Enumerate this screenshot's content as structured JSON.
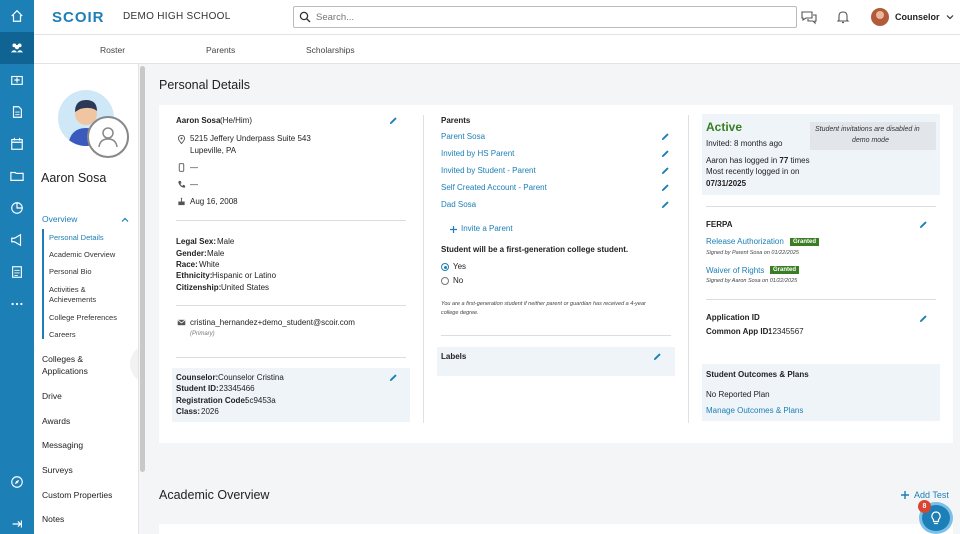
{
  "brand": {
    "logo": "SCOIR",
    "school": "DEMO HIGH SCHOOL",
    "accent": "#1c7fb6"
  },
  "search": {
    "placeholder": "Search..."
  },
  "user": {
    "name": "Counselor"
  },
  "rail_icons": [
    "home-icon",
    "users-icon",
    "college-icon",
    "document-icon",
    "calendar-icon",
    "folder-icon",
    "pie-chart-icon",
    "megaphone-icon",
    "list-icon",
    "more-icon",
    "compass-icon",
    "expand-icon"
  ],
  "subnav": {
    "tabs": [
      "Roster",
      "Parents",
      "Scholarships"
    ]
  },
  "student": {
    "name": "Aaron Sosa"
  },
  "leftnav": {
    "overview": "Overview",
    "overview_items": [
      "Personal Details",
      "Academic Overview",
      "Personal Bio",
      "Activities &",
      "Achievements",
      "College Preferences",
      "Careers"
    ],
    "sections": [
      "Colleges &",
      "Applications",
      "Drive",
      "Awards",
      "Messaging",
      "Surveys",
      "Custom Properties",
      "Notes"
    ]
  },
  "page": {
    "title": "Personal Details",
    "section2": "Academic Overview",
    "add_test": "Add Test"
  },
  "col1": {
    "name": "Aaron Sosa",
    "pronouns": "(He/Him)",
    "address1": "5215 Jeffery Underpass Suite 543",
    "address2": "Lupeville, PA",
    "mobile": "—",
    "phone": "—",
    "birthday": "Aug 16, 2008",
    "demographics": [
      {
        "label": "Legal Sex:",
        "value": "Male"
      },
      {
        "label": "Gender:",
        "value": "Male"
      },
      {
        "label": "Race:",
        "value": "White"
      },
      {
        "label": "Ethnicity:",
        "value": "Hispanic or Latino"
      },
      {
        "label": "Citizenship:",
        "value": "United States"
      }
    ],
    "email": "cristina_hernandez+demo_student@scoir.com",
    "email_tag": "(Primary)",
    "school_info": [
      {
        "label": "Counselor:",
        "value": "Counselor Cristina"
      },
      {
        "label": "Student ID:",
        "value": "23345466"
      },
      {
        "label": "Registration Code:",
        "value": "5c9453a"
      },
      {
        "label": "Class:",
        "value": "2026"
      }
    ]
  },
  "col2": {
    "title": "Parents",
    "parents": [
      "Parent Sosa",
      "Invited by HS Parent",
      "Invited by Student - Parent",
      "Self Created Account - Parent",
      "Dad Sosa"
    ],
    "invite": "Invite a Parent",
    "first_gen_q": "Student will be a first-generation college student.",
    "yes": "Yes",
    "no": "No",
    "first_gen_selected": "Yes",
    "note1": "You are a first-generation student if neither parent or guardian has received a 4-year",
    "note2": "college degree.",
    "labels": "Labels"
  },
  "col3": {
    "status": "Active",
    "invited": "Invited: 8 months ago",
    "demo_note1": "Student invitations are disabled in",
    "demo_note2": "demo mode",
    "login_prefix": "Aaron has logged in ",
    "login_count": "77",
    "login_suffix": " times",
    "recent": "Most recently logged in on",
    "recent_date": "07/31/2025",
    "ferpa": "FERPA",
    "release": "Release Authorization",
    "release_badge": "Granted",
    "release_sig": "Signed by Parent Sosa on 01/22/2025",
    "waiver": "Waiver of Rights",
    "waiver_badge": "Granted",
    "waiver_sig": "Signed by Aaron Sosa on 01/22/2025",
    "app_id_title": "Application ID",
    "common_app_label": "Common App ID:",
    "common_app_value": "12345567",
    "outcomes_title": "Student Outcomes & Plans",
    "outcomes_none": "No Reported Plan",
    "outcomes_link": "Manage Outcomes & Plans"
  },
  "help": {
    "badge": "8"
  }
}
